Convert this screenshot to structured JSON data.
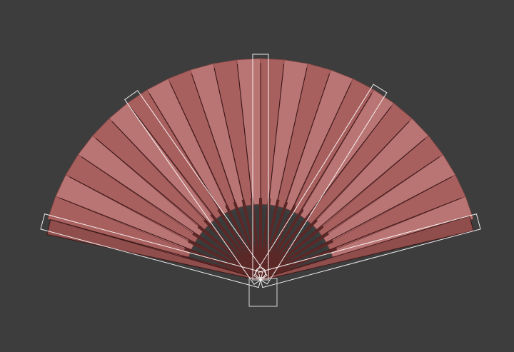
{
  "viewport": {
    "background": "#3d3d3d",
    "object": "folding-fan",
    "colors": {
      "leaf_main": "#a8605f",
      "leaf_light": "#b97574",
      "leaf_shadow": "#7f4342",
      "rib": "#3d1818",
      "guard": "#8f4e4c",
      "selection_wire": "#ffffff",
      "pivot_box": "#d8d8d8"
    },
    "selection_helpers": [
      "left-guard-outline",
      "center-stick-outline",
      "right-guard-outline",
      "pivot-box"
    ]
  }
}
